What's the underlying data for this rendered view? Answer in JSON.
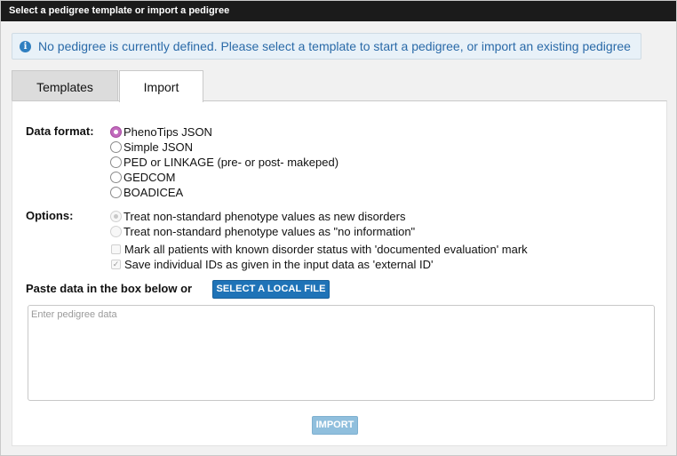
{
  "window": {
    "title": "Select a pedigree template or import a pedigree"
  },
  "info": {
    "icon": "info-icon",
    "text": "No pedigree is currently defined. Please select a template to start a pedigree, or import an existing pedigree"
  },
  "tabs": [
    {
      "label": "Templates",
      "active": false
    },
    {
      "label": "Import",
      "active": true
    }
  ],
  "data_format": {
    "label": "Data format:",
    "options": [
      {
        "label": "PhenoTips JSON",
        "selected": true
      },
      {
        "label": "Simple JSON",
        "selected": false
      },
      {
        "label": "PED or LINKAGE (pre- or post- makeped)",
        "selected": false
      },
      {
        "label": "GEDCOM",
        "selected": false
      },
      {
        "label": "BOADICEA",
        "selected": false
      }
    ]
  },
  "options": {
    "label": "Options:",
    "radios": [
      {
        "label": "Treat non-standard phenotype values as new disorders",
        "selected": true,
        "disabled": true
      },
      {
        "label": "Treat non-standard phenotype values as \"no information\"",
        "selected": false,
        "disabled": true
      }
    ],
    "checkboxes": [
      {
        "label": "Mark all patients with known disorder status with 'documented evaluation' mark",
        "checked": false,
        "disabled": true
      },
      {
        "label": "Save individual IDs as given in the input data as 'external ID'",
        "checked": true,
        "disabled": true
      }
    ]
  },
  "paste": {
    "label": "Paste data in the box below or",
    "select_file_label": "SELECT A LOCAL FILE",
    "placeholder": "Enter pedigree data",
    "value": ""
  },
  "import_button": {
    "label": "IMPORT",
    "disabled": true
  },
  "colors": {
    "accent": "#1f73b7",
    "radio_selected": "#c26bbd",
    "info_text": "#2a6aa8",
    "titlebar": "#1b1b1b"
  }
}
